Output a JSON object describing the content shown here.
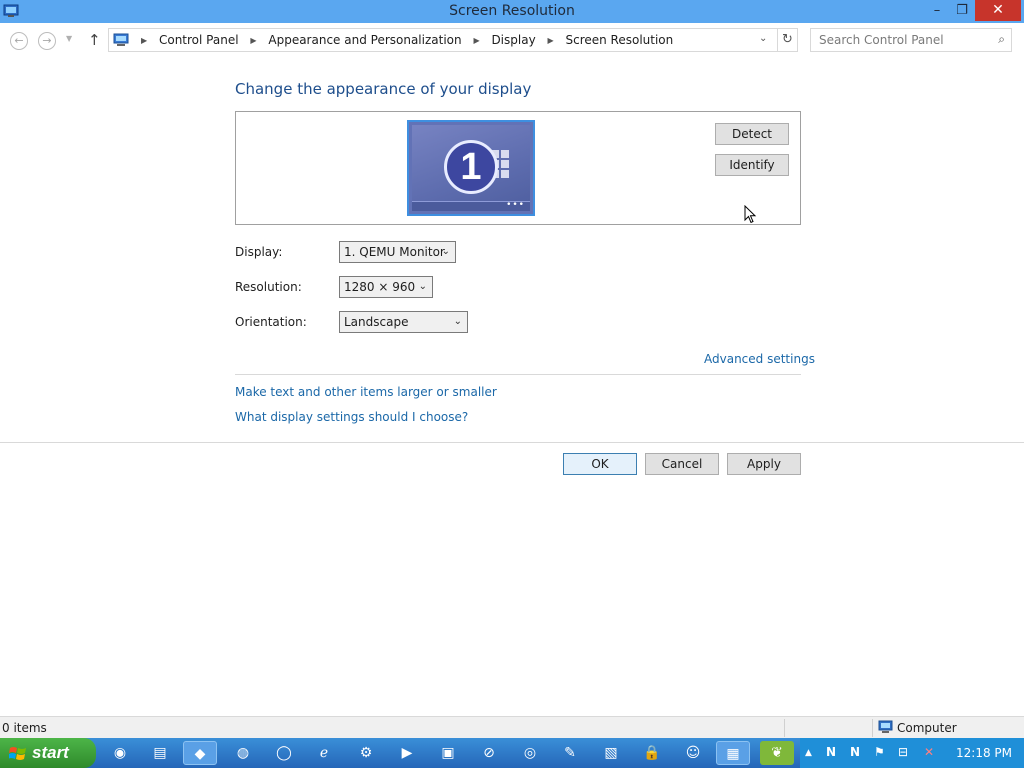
{
  "window": {
    "title": "Screen Resolution",
    "minimize": "–",
    "maximize": "❐",
    "close": "✕"
  },
  "nav": {
    "back_icon": "←",
    "forward_icon": "→",
    "recent_icon": "▼",
    "up_icon": "↑",
    "breadcrumbs": [
      "Control Panel",
      "Appearance and Personalization",
      "Display",
      "Screen Resolution"
    ],
    "separator": "▶",
    "dropdown_icon": "⌄",
    "refresh_icon": "↻"
  },
  "search": {
    "placeholder": "Search Control Panel",
    "icon": "⌕"
  },
  "main": {
    "heading": "Change the appearance of your display",
    "monitor_number": "1",
    "monitor_dots": "•••",
    "detect_label": "Detect",
    "identify_label": "Identify",
    "display_label": "Display:",
    "display_value": "1. QEMU Monitor",
    "resolution_label": "Resolution:",
    "resolution_value": "1280 × 960",
    "orientation_label": "Orientation:",
    "orientation_value": "Landscape",
    "select_arrow": "⌄",
    "advanced_link": "Advanced settings",
    "link_text_size": "Make text and other items larger or smaller",
    "link_help": "What display settings should I choose?",
    "ok_label": "OK",
    "cancel_label": "Cancel",
    "apply_label": "Apply"
  },
  "statusbar": {
    "items": "0 items",
    "location": "Computer"
  },
  "taskbar": {
    "start_label": "start",
    "apps": [
      {
        "name": "chrome-icon",
        "glyph": "◉"
      },
      {
        "name": "file-explorer-icon",
        "glyph": "▤"
      },
      {
        "name": "app-drop-icon",
        "glyph": "◆"
      },
      {
        "name": "firefox-icon",
        "glyph": "◍"
      },
      {
        "name": "opera-icon",
        "glyph": "◯"
      },
      {
        "name": "internet-explorer-icon",
        "glyph": "ℯ"
      },
      {
        "name": "steam-icon",
        "glyph": "⚙"
      },
      {
        "name": "media-player-icon",
        "glyph": "▶"
      },
      {
        "name": "window-switcher-icon",
        "glyph": "▣"
      },
      {
        "name": "no-entry-icon",
        "glyph": "⊘"
      },
      {
        "name": "network-globe-icon",
        "glyph": "◎"
      },
      {
        "name": "notepad-icon",
        "glyph": "✎"
      },
      {
        "name": "image-viewer-icon",
        "glyph": "▧"
      },
      {
        "name": "lock-icon",
        "glyph": "🔒"
      },
      {
        "name": "game-icon",
        "glyph": "☺"
      },
      {
        "name": "control-panel-icon",
        "glyph": "▦"
      },
      {
        "name": "leaf-app-icon",
        "glyph": "❦"
      }
    ],
    "tray_up_icon": "▲",
    "tray_icons": [
      "N",
      "N",
      "⚑",
      "⊟",
      "✕"
    ],
    "clock": "12:18 PM"
  },
  "colors": {
    "titlebar": "#5aa7f0",
    "close_button": "#c7342b",
    "link": "#1b68a8",
    "heading": "#1e4e8c",
    "taskbar": "#2566b8",
    "start": "#3a9f36"
  }
}
